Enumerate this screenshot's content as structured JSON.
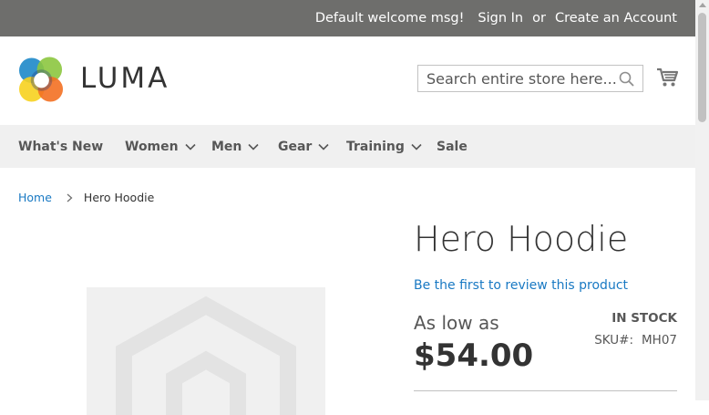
{
  "topbar": {
    "welcome": "Default welcome msg!",
    "sign_in": "Sign In",
    "or": "or",
    "create_account": "Create an Account"
  },
  "header": {
    "logo_text": "LUMA",
    "search_placeholder": "Search entire store here..."
  },
  "nav": {
    "items": [
      {
        "label": "What's New",
        "has_dropdown": false
      },
      {
        "label": "Women",
        "has_dropdown": true
      },
      {
        "label": "Men",
        "has_dropdown": true
      },
      {
        "label": "Gear",
        "has_dropdown": true
      },
      {
        "label": "Training",
        "has_dropdown": true
      },
      {
        "label": "Sale",
        "has_dropdown": false
      }
    ]
  },
  "breadcrumb": {
    "home": "Home",
    "current": "Hero Hoodie"
  },
  "product": {
    "title": "Hero Hoodie",
    "review_link": "Be the first to review this product",
    "as_low_as": "As low as",
    "price": "$54.00",
    "stock": "In stock",
    "sku_label": "SKU#:",
    "sku": "MH07"
  },
  "colors": {
    "topbar_bg": "#6e6e6c",
    "link": "#1979c3",
    "nav_bg": "#f0f0f0"
  }
}
